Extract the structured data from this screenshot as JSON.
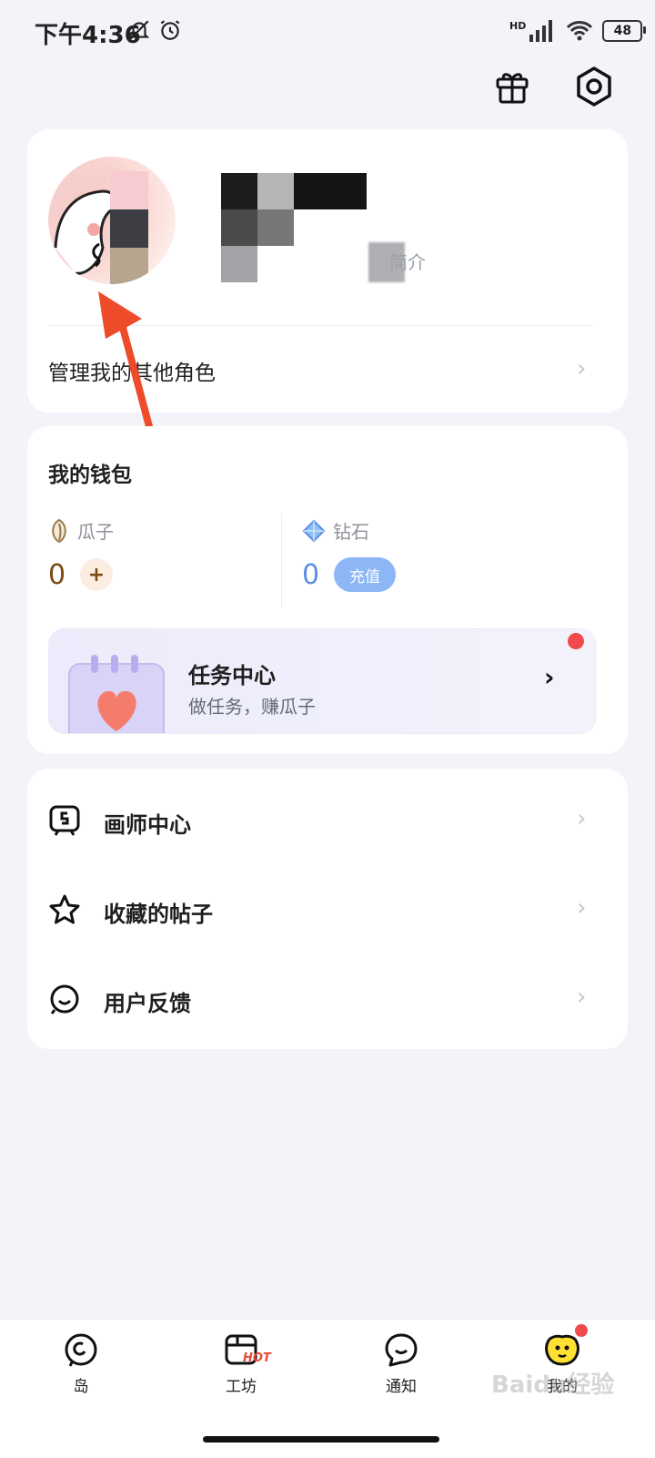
{
  "status_bar": {
    "time": "下午4:36",
    "network": "HD",
    "battery": "48"
  },
  "header": {
    "gift_icon": "gift-icon",
    "settings_icon": "settings-icon"
  },
  "profile": {
    "bio_placeholder": "简介",
    "manage_roles_label": "管理我的其他角色"
  },
  "wallet": {
    "title": "我的钱包",
    "seeds": {
      "label": "瓜子",
      "value": "0",
      "add_label": "+"
    },
    "diamonds": {
      "label": "钻石",
      "value": "0",
      "recharge_label": "充值"
    },
    "task_center": {
      "title": "任务中心",
      "subtitle": "做任务，赚瓜子"
    }
  },
  "menu": {
    "items": [
      {
        "label": "画师中心",
        "icon": "artist-icon"
      },
      {
        "label": "收藏的帖子",
        "icon": "star-icon"
      },
      {
        "label": "用户反馈",
        "icon": "feedback-icon"
      }
    ]
  },
  "bottom_nav": {
    "items": [
      {
        "label": "岛",
        "icon": "island-icon"
      },
      {
        "label": "工坊",
        "icon": "workshop-icon",
        "badge": "HOT"
      },
      {
        "label": "通知",
        "icon": "notification-icon"
      },
      {
        "label": "我的",
        "icon": "mine-icon"
      }
    ]
  },
  "watermark": "Baidu经验",
  "colors": {
    "accent_red": "#f04a4a",
    "recharge_blue": "#8cb6f5",
    "seed_brown": "#7a4a14",
    "diamond_blue": "#5b8ee6"
  }
}
